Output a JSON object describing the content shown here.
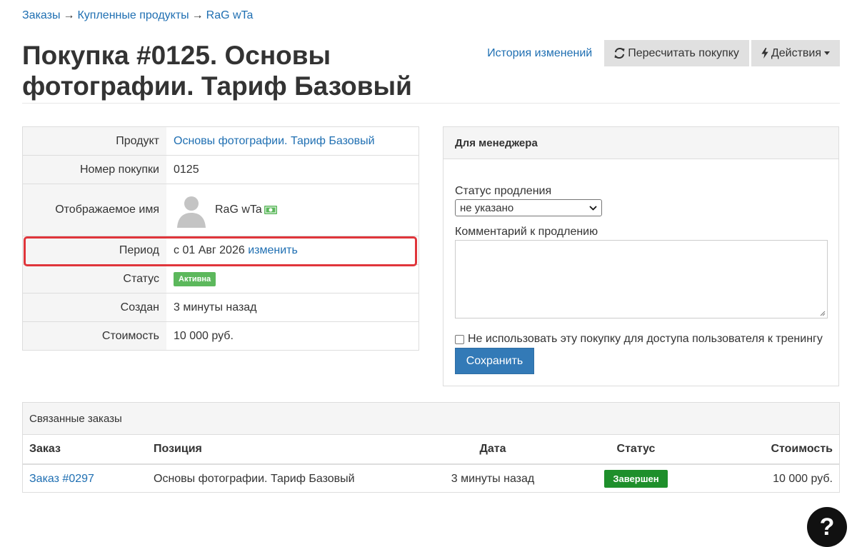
{
  "breadcrumb": {
    "items": [
      "Заказы",
      "Купленные продукты",
      "RaG wTa"
    ],
    "separator": "→"
  },
  "page": {
    "title": "Покупка #0125. Основы фотографии. Тариф Базовый"
  },
  "header": {
    "history_label": "История изменений",
    "recalc_label": "Пересчитать покупку",
    "actions_label": "Действия"
  },
  "details": {
    "product_label": "Продукт",
    "product_value": "Основы фотографии. Тариф Базовый",
    "number_label": "Номер покупки",
    "number_value": "0125",
    "name_label": "Отображаемое имя",
    "name_value": "RaG wTa",
    "period_label": "Период",
    "period_value": "с 01 Авг 2026",
    "period_change": "изменить",
    "status_label": "Статус",
    "status_value": "Активна",
    "created_label": "Создан",
    "created_value": "3 минуты назад",
    "cost_label": "Стоимость",
    "cost_value": "10 000 руб."
  },
  "manager": {
    "title": "Для менеджера",
    "renewal_status_label": "Статус продления",
    "renewal_status_value": "не указано",
    "comment_label": "Комментарий к продлению",
    "comment_value": "",
    "checkbox_label": "Не использовать эту покупку для доступа пользователя к тренингу",
    "save_label": "Сохранить"
  },
  "orders": {
    "title": "Связанные заказы",
    "columns": [
      "Заказ",
      "Позиция",
      "Дата",
      "Статус",
      "Стоимость"
    ],
    "rows": [
      {
        "order": "Заказ #0297",
        "position": "Основы фотографии. Тариф Базовый",
        "date": "3 минуты назад",
        "status": "Завершен",
        "cost": "10 000 руб."
      }
    ]
  },
  "help": {
    "label": "?"
  },
  "colors": {
    "link": "#1f6fb2",
    "active_badge": "#5cb85c",
    "done_badge": "#1e8f2b",
    "primary": "#337ab7",
    "highlight": "#e0353b"
  }
}
